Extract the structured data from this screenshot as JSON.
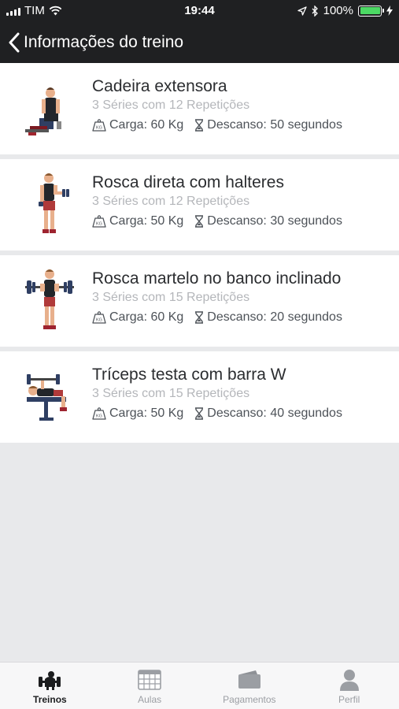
{
  "status_bar": {
    "carrier": "TIM",
    "time": "19:44",
    "battery_percent": "100%",
    "battery_level": 1.0
  },
  "nav": {
    "title": "Informações do treino",
    "back_icon": "chevron-left-icon"
  },
  "exercises": [
    {
      "name": "Cadeira extensora",
      "series": "3 Séries com 12 Repetições",
      "carga": "Carga: 60 Kg",
      "descanso": "Descanso: 50 segundos"
    },
    {
      "name": "Rosca direta com halteres",
      "series": "3 Séries com 12 Repetições",
      "carga": "Carga: 50 Kg",
      "descanso": "Descanso: 30 segundos"
    },
    {
      "name": "Rosca martelo no banco inclinado",
      "series": "3 Séries com 15 Repetições",
      "carga": "Carga: 60 Kg",
      "descanso": "Descanso: 20 segundos"
    },
    {
      "name": "Tríceps testa com barra W",
      "series": "3 Séries com 15 Repetições",
      "carga": "Carga: 50 Kg",
      "descanso": "Descanso: 40 segundos"
    }
  ],
  "tabbar": {
    "tabs": [
      {
        "label": "Treinos",
        "icon": "dumbbell-icon",
        "active": true
      },
      {
        "label": "Aulas",
        "icon": "calendar-grid-icon",
        "active": false
      },
      {
        "label": "Pagamentos",
        "icon": "wallet-icon",
        "active": false
      },
      {
        "label": "Perfil",
        "icon": "user-icon",
        "active": false
      }
    ]
  },
  "colors": {
    "header_bg": "#1f2022",
    "page_bg": "#e8e9eb",
    "battery_green": "#4cd964",
    "muted_text": "#b4b6ba"
  }
}
